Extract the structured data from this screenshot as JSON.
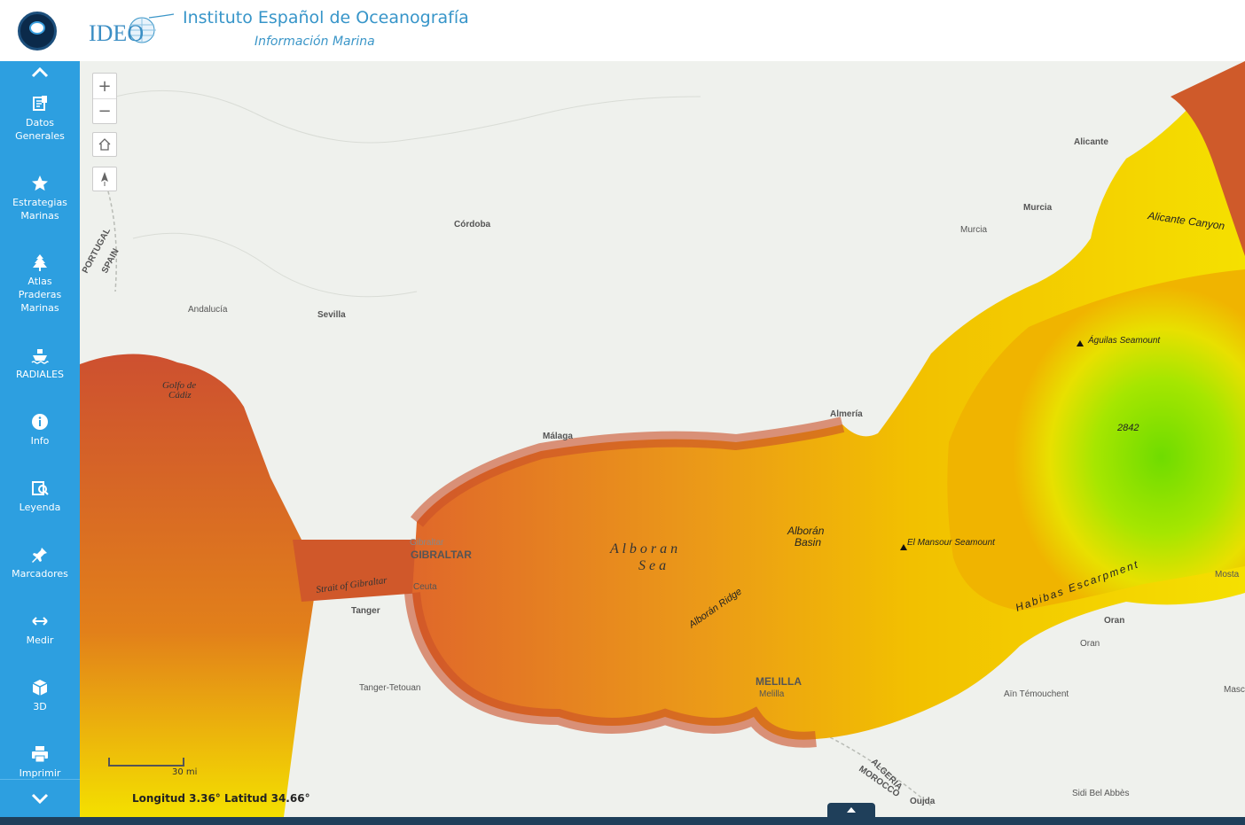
{
  "header": {
    "title": "Instituto Español de Oceanografía",
    "subtitle": "Información Marina",
    "logo_text": "IDEO"
  },
  "sidebar": {
    "items": [
      {
        "label": "Datos\nGenerales",
        "icon": "data-icon"
      },
      {
        "label": "Estrategias\nMarinas",
        "icon": "star-icon"
      },
      {
        "label": "Atlas\nPraderas\nMarinas",
        "icon": "tree-icon"
      },
      {
        "label": "RADIALES",
        "icon": "ship-icon"
      },
      {
        "label": "Info",
        "icon": "info-icon"
      },
      {
        "label": "Leyenda",
        "icon": "legend-icon"
      },
      {
        "label": "Marcadores",
        "icon": "pin-icon"
      },
      {
        "label": "Medir",
        "icon": "measure-icon"
      },
      {
        "label": "3D",
        "icon": "cube-icon"
      },
      {
        "label": "Imprimir",
        "icon": "print-icon"
      }
    ]
  },
  "map": {
    "zoom_in": "+",
    "zoom_out": "−",
    "scale_label": "30 mi",
    "coords": "Longitud 3.36° Latitud 34.66°",
    "colors": {
      "deep": "#7ee000",
      "mid": "#f5d400",
      "shallow": "#d2562a",
      "land": "#eef0ec"
    },
    "labels": {
      "portugal": "PORTUGAL",
      "spain": "SPAIN",
      "andalucia": "Andalucía",
      "sevilla": "Sevilla",
      "cordoba": "Córdoba",
      "golfo1": "Golfo de",
      "golfo2": "Cádiz",
      "malaga": "Málaga",
      "almeria": "Almería",
      "murcia1": "Murcia",
      "murcia2": "Murcia",
      "alicante": "Alicante",
      "alicante_canyon": "Alicante Canyon",
      "aguilas": "Águilas Seamount",
      "depth": "2842",
      "gibraltar_small": "Gibraltar",
      "gibraltar": "GIBRALTAR",
      "strait": "Strait of Gibraltar",
      "tanger": "Tanger",
      "ceuta": "Ceuta",
      "alboran_sea1": "A l b o r a n",
      "alboran_sea2": "S e a",
      "basin1": "Alborán",
      "basin2": "Basin",
      "mansour": "El Mansour Seamount",
      "ridge": "Alborán Ridge",
      "habibas": "Habibas Escarpment",
      "melilla_big": "MELILLA",
      "melilla": "Melilla",
      "tanger_tetouan": "Tanger-Tetouan",
      "oran1": "Oran",
      "oran2": "Oran",
      "temouchent": "Aïn Témouchent",
      "algeria": "ALGERIA",
      "morocco": "MOROCCO",
      "oujda": "Oujda",
      "sidi": "Sidi Bel Abbès",
      "mosta": "Mosta",
      "masc": "Masc"
    }
  }
}
